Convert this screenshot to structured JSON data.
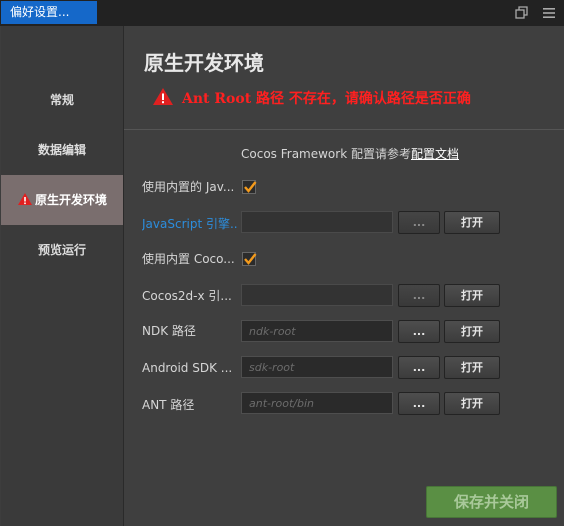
{
  "window": {
    "title": "偏好设置..."
  },
  "sidebar": {
    "items": [
      {
        "label": "常规"
      },
      {
        "label": "数据编辑"
      },
      {
        "label": "原生开发环境"
      },
      {
        "label": "预览运行"
      }
    ]
  },
  "main": {
    "title": "原生开发环境",
    "error": "Ant Root 路径 不存在，请确认路径是否正确",
    "doc": {
      "prefix": "Cocos Framework 配置请参考",
      "link": "配置文档"
    },
    "rows": [
      {
        "label": "使用内置的 Jav...",
        "checked": true
      },
      {
        "label": "JavaScript 引擎...",
        "placeholder": "",
        "dots": "...",
        "open": "打开"
      },
      {
        "label": "使用内置 Coco...",
        "checked": true
      },
      {
        "label": "Cocos2d-x 引...",
        "placeholder": "",
        "dots": "...",
        "open": "打开"
      },
      {
        "label": "NDK 路径",
        "placeholder": "ndk-root",
        "dots": "...",
        "open": "打开"
      },
      {
        "label": "Android SDK ...",
        "placeholder": "sdk-root",
        "dots": "...",
        "open": "打开"
      },
      {
        "label": "ANT 路径",
        "placeholder": "ant-root/bin",
        "dots": "...",
        "open": "打开"
      }
    ],
    "save_label": "保存并关闭"
  },
  "colors": {
    "accent": "#1568c9",
    "error": "#ff2020",
    "link": "#2c8ddc",
    "save": "#5a8f44",
    "check": "#f39a1c"
  }
}
